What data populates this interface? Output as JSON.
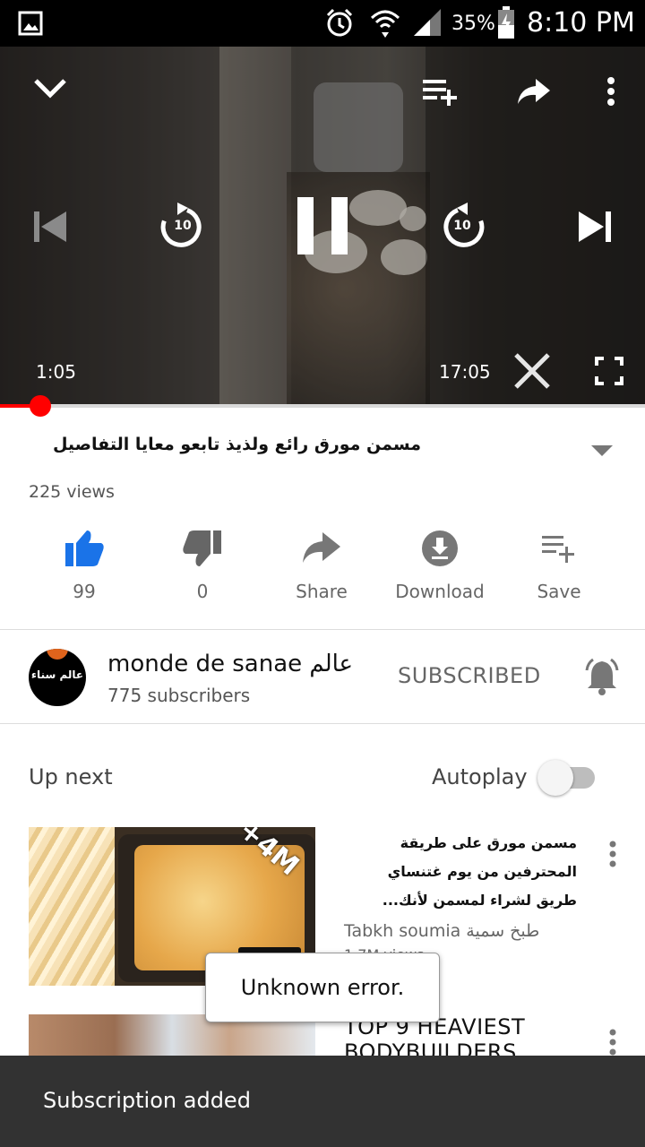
{
  "status_bar": {
    "battery": "35%",
    "time": "8:10 PM",
    "icons": [
      "gallery-icon",
      "alarm-icon",
      "wifi-icon",
      "signal-icon",
      "battery-icon"
    ]
  },
  "player": {
    "current_time": "1:05",
    "total_time": "17:05",
    "progress": 0.063,
    "skip_back_seconds": "10",
    "skip_forward_seconds": "10",
    "icons": [
      "collapse-icon",
      "add-to-playlist-icon",
      "share-icon",
      "more-icon",
      "previous-icon",
      "rewind-10-icon",
      "pause-icon",
      "forward-10-icon",
      "next-icon",
      "close-icon",
      "fullscreen-icon"
    ]
  },
  "video": {
    "title": "مسمن مورق رائع ولذيذ تابعو معايا التفاصيل",
    "views": "225 views"
  },
  "actions": [
    {
      "label": "99",
      "icon": "like-icon"
    },
    {
      "label": "0",
      "icon": "dislike-icon"
    },
    {
      "label": "Share",
      "icon": "share-icon"
    },
    {
      "label": "Download",
      "icon": "download-icon"
    },
    {
      "label": "Save",
      "icon": "save-icon"
    }
  ],
  "channel": {
    "avatar_text": "عالم سناء",
    "name": "monde de sanae عالم",
    "subscribers": "775 subscribers",
    "subscribe_label": "SUBSCRIBED"
  },
  "up_next": {
    "label": "Up next",
    "autoplay_label": "Autoplay",
    "autoplay_on": false
  },
  "videos": [
    {
      "title_line1": "مسمن مورق على طريقة",
      "title_line2": "المحترفين من يوم غتنساي",
      "title_line3": "طريق لشراء لمسمن لأنك...",
      "channel": "Tabkh soumia طبخ سمية",
      "meta": "1.7M views",
      "thumb_tag": "+4M"
    },
    {
      "title_line1": "TOP 9 HEAVIEST",
      "title_line2": "BODYBUILDERS"
    }
  ],
  "toast": "Unknown error.",
  "snackbar": "Subscription added",
  "colors": {
    "accent_red": "#ff0000",
    "like_blue": "#1a73e8",
    "snackbar_bg": "#323232"
  }
}
